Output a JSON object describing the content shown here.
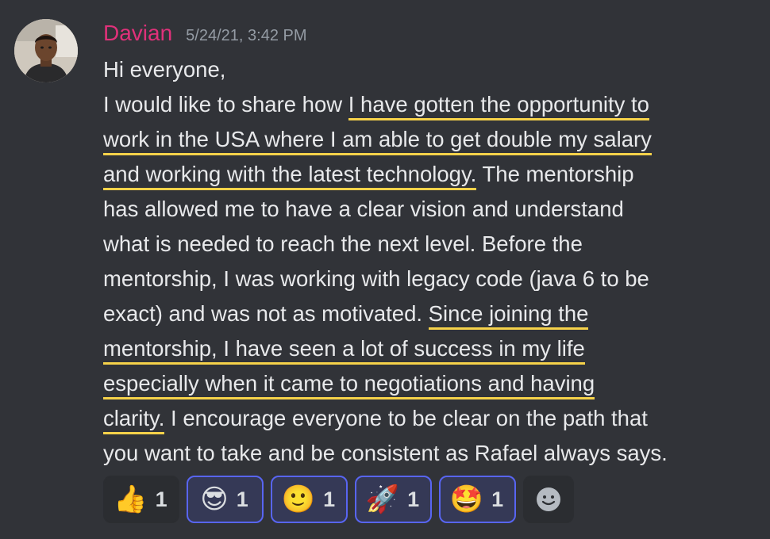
{
  "message": {
    "author": "Davian",
    "timestamp": "5/24/21, 3:42 PM",
    "lines": [
      [
        {
          "t": "Hi everyone,"
        }
      ],
      [
        {
          "t": "I would like to share how "
        },
        {
          "t": "I have gotten the opportunity to",
          "hl": true
        }
      ],
      [
        {
          "t": "work in the USA where I am able to get double my salary",
          "hl": true
        }
      ],
      [
        {
          "t": "and working with the latest technology.",
          "hl": true
        },
        {
          "t": " The mentorship"
        }
      ],
      [
        {
          "t": "has allowed me to have a clear vision and understand"
        }
      ],
      [
        {
          "t": "what is needed to reach the next level. Before the"
        }
      ],
      [
        {
          "t": "mentorship, I was working with legacy code (java 6 to be"
        }
      ],
      [
        {
          "t": "exact) and was not as motivated. "
        },
        {
          "t": "Since joining the ",
          "hl": true
        }
      ],
      [
        {
          "t": "mentorship, I have seen a lot of success in my life",
          "hl": true
        }
      ],
      [
        {
          "t": "especially when it came to negotiations and having",
          "hl": true
        }
      ],
      [
        {
          "t": "clarity.",
          "hl": true
        },
        {
          "t": " I encourage everyone to be clear on the path that"
        }
      ],
      [
        {
          "t": "you want to take and be consistent as Rafael always says."
        }
      ]
    ]
  },
  "reactions": [
    {
      "emoji": "👍",
      "name": "thumbs-up",
      "count": "1",
      "me": false
    },
    {
      "emoji": "😎",
      "name": "sunglasses",
      "count": "1",
      "me": true
    },
    {
      "emoji": "🙂",
      "name": "slight-smile",
      "count": "1",
      "me": true
    },
    {
      "emoji": "🚀",
      "name": "rocket",
      "count": "1",
      "me": true
    },
    {
      "emoji": "🤩",
      "name": "star-struck",
      "count": "1",
      "me": true
    }
  ],
  "colors": {
    "background": "#313338",
    "username": "#e0317a",
    "highlight": "#f6d24a",
    "reaction_selected_border": "#5865f2"
  },
  "icons": {
    "add_reaction": "add-reaction-icon"
  }
}
